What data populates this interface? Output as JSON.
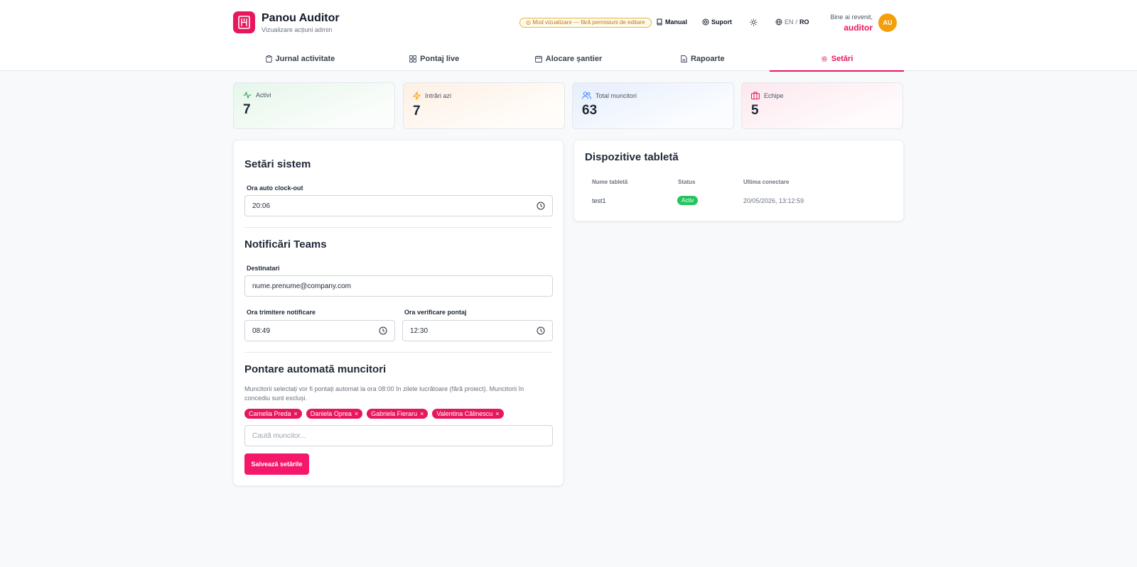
{
  "header": {
    "title": "Panou Auditor",
    "subtitle": "Vizualizare acțiuni admin",
    "mode_badge": "Mod vizualizare — fără permisiuni de editare",
    "manual_label": "Manual",
    "support_label": "Suport",
    "lang_en": "EN",
    "lang_sep": "/",
    "lang_ro": "RO",
    "welcome": "Bine ai revenit,",
    "username": "auditor",
    "avatar_initials": "AU"
  },
  "tabs": [
    {
      "label": "Jurnal activitate",
      "icon": "clipboard-icon"
    },
    {
      "label": "Pontaj live",
      "icon": "grid-icon"
    },
    {
      "label": "Alocare șantier",
      "icon": "calendar-icon"
    },
    {
      "label": "Rapoarte",
      "icon": "file-icon"
    },
    {
      "label": "Setări",
      "icon": "gear-icon",
      "active": true
    }
  ],
  "stats": [
    {
      "label": "Activi",
      "value": "7",
      "icon": "activity-icon",
      "color": "#22a55a"
    },
    {
      "label": "Intrări azi",
      "value": "7",
      "icon": "zap-icon",
      "color": "#f59e0b"
    },
    {
      "label": "Total muncitori",
      "value": "63",
      "icon": "users-icon",
      "color": "#3b82f6"
    },
    {
      "label": "Echipe",
      "value": "5",
      "icon": "briefcase-icon",
      "color": "#e8175d"
    }
  ],
  "settings": {
    "system_title": "Setări sistem",
    "auto_clockout_label": "Ora auto clock-out",
    "auto_clockout_value": "20:06",
    "teams_title": "Notificări Teams",
    "recipients_label": "Destinatari",
    "recipients_value": "nume.prenume@company.com",
    "notify_time_label": "Ora trimitere notificare",
    "notify_time_value": "08:49",
    "check_time_label": "Ora verificare pontaj",
    "check_time_value": "12:30",
    "auto_title": "Pontare automată muncitori",
    "auto_desc": "Muncitorii selectați vor fi pontați automat la ora 08:00 în zilele lucrătoare (fără proiect). Muncitorii în concediu sunt excluși.",
    "workers": [
      "Camelia Preda",
      "Daniela Oprea",
      "Gabriela Fieraru",
      "Valentina Călinescu"
    ],
    "chip_remove": "×",
    "search_placeholder": "Caută muncitor...",
    "save_label": "Salvează setările"
  },
  "devices": {
    "title": "Dispozitive tabletă",
    "columns": [
      "Nume tabletă",
      "Status",
      "Ultima conectare"
    ],
    "rows": [
      {
        "name": "test1",
        "status": "Activ",
        "last_seen": "20/05/2026, 13:12:59"
      }
    ]
  },
  "colors": {
    "accent": "#e8175d",
    "active_status": "#22c55e",
    "avatar": "#f59e0b"
  }
}
